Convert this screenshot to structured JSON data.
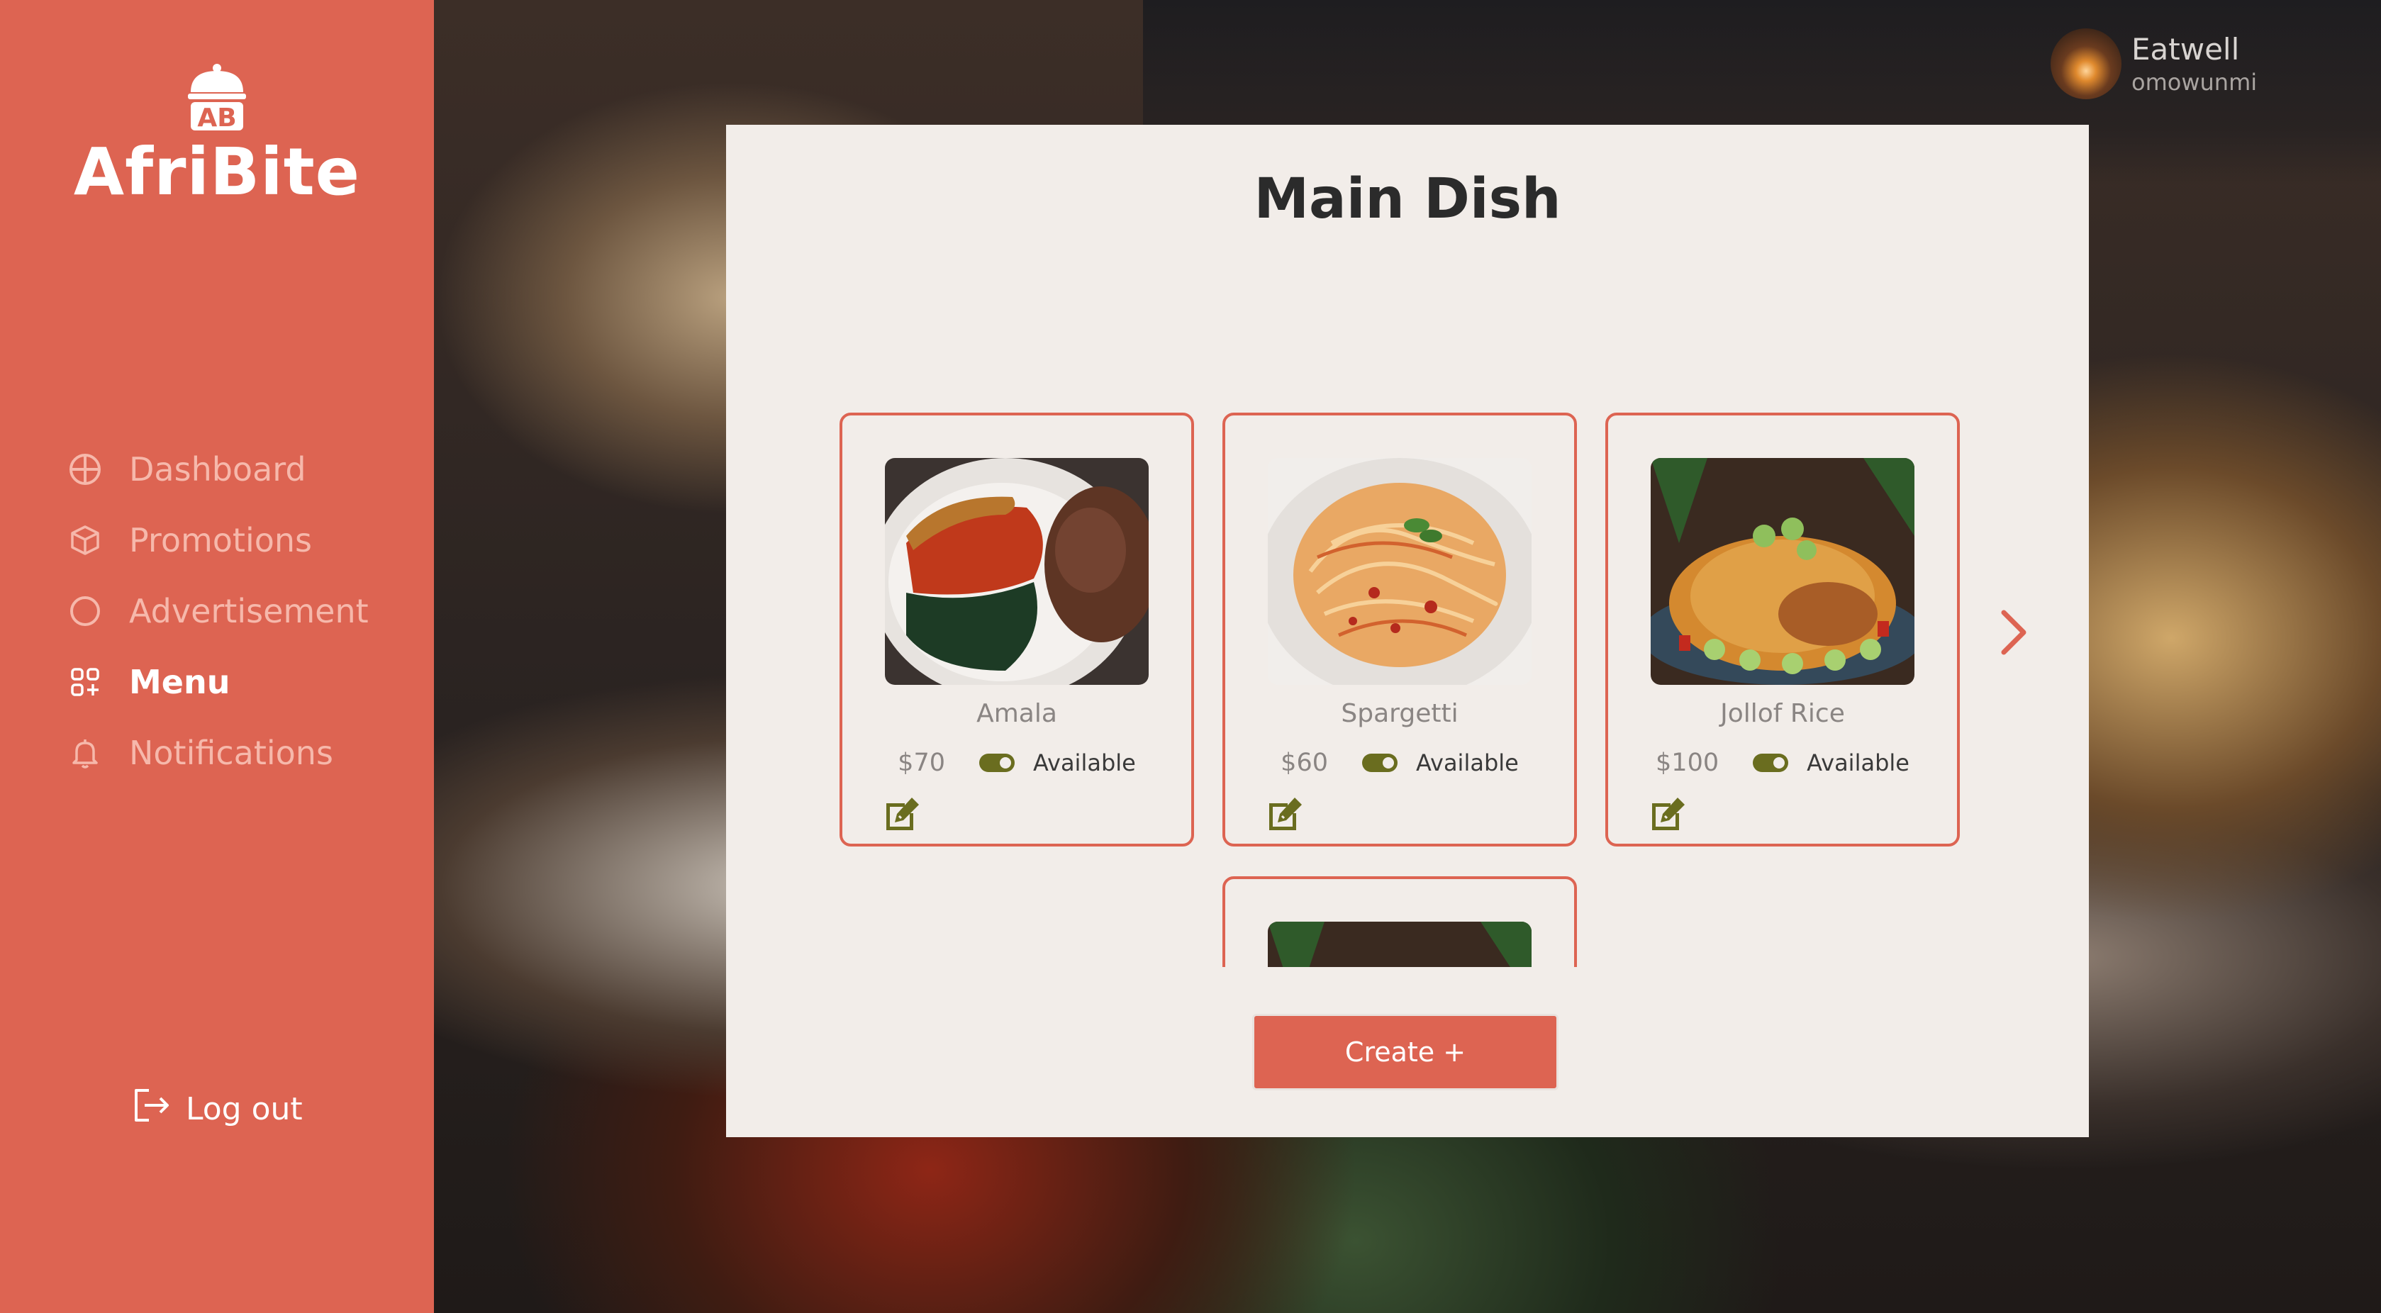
{
  "brand": {
    "logo_initials": "AB",
    "name": "AfriBite"
  },
  "sidebar": {
    "items": [
      {
        "label": "Dashboard",
        "icon": "dashboard-icon",
        "active": false
      },
      {
        "label": "Promotions",
        "icon": "box-icon",
        "active": false
      },
      {
        "label": "Advertisement",
        "icon": "circle-icon",
        "active": false
      },
      {
        "label": "Menu",
        "icon": "grid-plus-icon",
        "active": true
      },
      {
        "label": "Notifications",
        "icon": "bell-icon",
        "active": false
      }
    ],
    "logout_label": "Log out"
  },
  "user": {
    "name": "Eatwell",
    "handle": "omowunmi"
  },
  "main": {
    "title": "Main Dish",
    "cards": [
      {
        "name": "Amala",
        "price": "$70",
        "status": "Available",
        "image": "amala-image"
      },
      {
        "name": "Spargetti",
        "price": "$60",
        "status": "Available",
        "image": "spaghetti-image"
      },
      {
        "name": "Jollof Rice",
        "price": "$100",
        "status": "Available",
        "image": "jollof-rice-image"
      },
      {
        "name": "",
        "price": "",
        "status": "",
        "image": "jollof-rice-image"
      }
    ],
    "create_label": "Create +"
  },
  "colors": {
    "sidebar": "#dd6452",
    "accent": "#dd6452",
    "panel": "#f2ede9",
    "toggle": "#6a6d1f",
    "edit_icon": "#6a6d1f"
  }
}
